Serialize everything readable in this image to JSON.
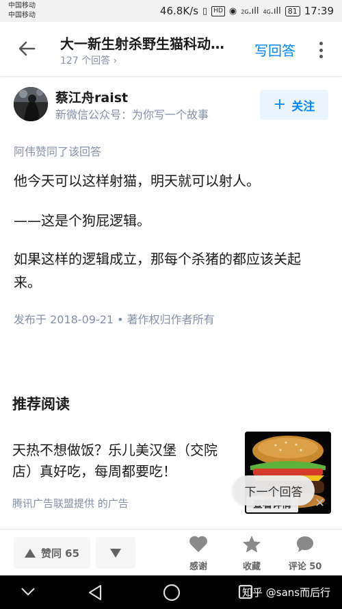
{
  "status_bar": {
    "carrier_1": "中国移动",
    "carrier_2": "中国移动",
    "speed": "46.8K/s",
    "signal_1": "2G",
    "signal_2": "4G",
    "battery": "81",
    "time": "17:39"
  },
  "header": {
    "question_title": "大一新生射杀野生猫科动…",
    "answer_count": "127 个回答",
    "write_answer": "写回答"
  },
  "author": {
    "name": "蔡江舟raist",
    "bio": "新微信公众号：为你写一个故事",
    "follow_label": "关注"
  },
  "answer": {
    "voted_by": "阿伟赞同了该回答",
    "paragraphs": [
      "他今天可以这样射猫，明天就可以射人。",
      "——这是个狗屁逻辑。",
      "如果这样的逻辑成立，那每个杀猪的都应该关起来。"
    ],
    "meta": "发布于 2018-09-21 • 著作权归作者所有"
  },
  "recommend": {
    "title": "推荐阅读",
    "ad_text": "天热不想做饭？乐儿美汉堡（交院店）真好吃，每周都要吃！",
    "ad_source": "腾讯广告联盟提供 的广告",
    "ad_button": "查看详情"
  },
  "next_answer": "下一个回答",
  "action_bar": {
    "vote_up": "赞同 65",
    "thanks": "感谢",
    "favorite": "收藏",
    "comment": "评论 50"
  },
  "watermark": "知乎 @sans而后行",
  "colors": {
    "accent": "#0084ff",
    "meta_gray": "#8590a6"
  }
}
